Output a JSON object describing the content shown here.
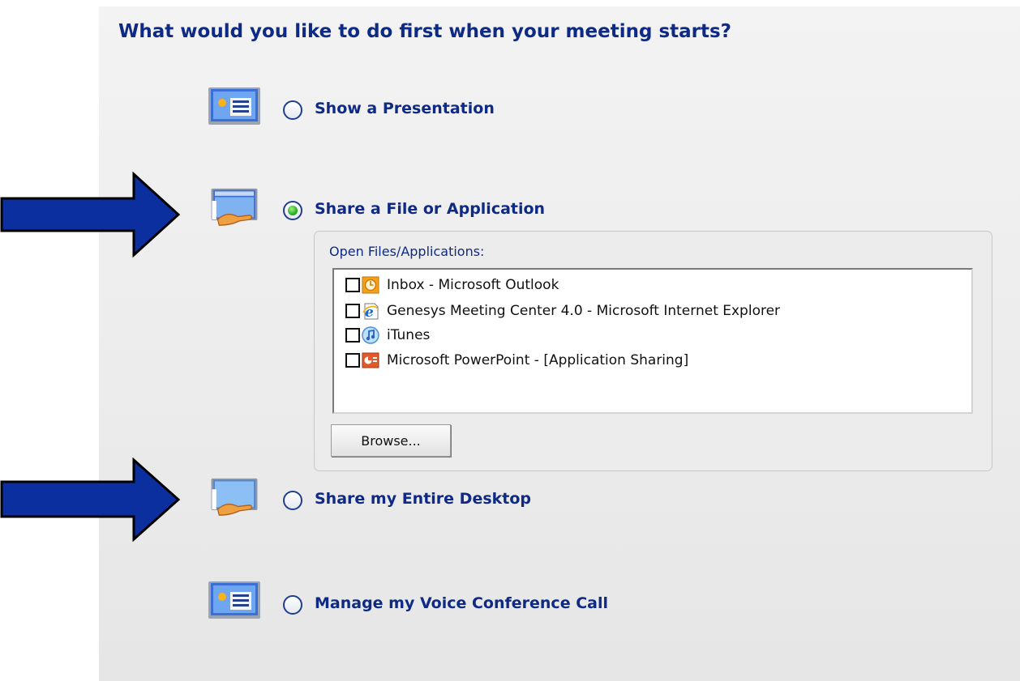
{
  "title": "What would you like to do first when your meeting starts?",
  "options": [
    {
      "label": "Show a Presentation",
      "selected": false,
      "icon": "presentation-icon"
    },
    {
      "label": "Share a File or Application",
      "selected": true,
      "icon": "share-app-icon"
    },
    {
      "label": "Share my Entire Desktop",
      "selected": false,
      "icon": "share-desktop-icon"
    },
    {
      "label": "Manage my Voice Conference Call",
      "selected": false,
      "icon": "presentation-icon"
    }
  ],
  "share_group": {
    "label": "Open Files/Applications:",
    "items": [
      {
        "label": "Inbox - Microsoft Outlook",
        "checked": false,
        "icon": "outlook-icon"
      },
      {
        "label": "Genesys Meeting Center 4.0 - Microsoft Internet Explorer",
        "checked": false,
        "icon": "internet-explorer-icon"
      },
      {
        "label": "iTunes",
        "checked": false,
        "icon": "itunes-icon"
      },
      {
        "label": "Microsoft PowerPoint - [Application  Sharing]",
        "checked": false,
        "icon": "powerpoint-icon"
      }
    ],
    "browse_label": "Browse..."
  },
  "colors": {
    "title": "#0e2a84",
    "arrow": "#0b2f9e",
    "selected_radio": "#1aa31a",
    "panel": "#ececec"
  }
}
